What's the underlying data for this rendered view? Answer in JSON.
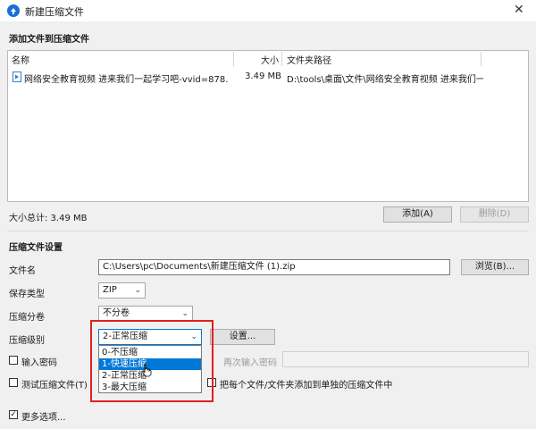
{
  "window": {
    "title": "新建压缩文件",
    "close_glyph": "✕",
    "icon": "app-logo-icon"
  },
  "add_files": {
    "section_title": "添加文件到压缩文件",
    "columns": {
      "name": "名称",
      "size": "大小",
      "path": "文件夹路径"
    },
    "rows": [
      {
        "name": "网络安全教育视频 进来我们一起学习吧-vvid=878...",
        "size": "3.49 MB",
        "path": "D:\\tools\\桌面\\文件\\网络安全教育视频 进来我们一..."
      }
    ],
    "total_label": "大小总计: 3.49 MB",
    "add_button": "添加(A)",
    "delete_button": "删除(D)"
  },
  "settings": {
    "section_title": "压缩文件设置",
    "filename_label": "文件名",
    "filename_value": "C:\\Users\\pc\\Documents\\新建压缩文件 (1).zip",
    "browse_button": "浏览(B)...",
    "type_label": "保存类型",
    "type_value": "ZIP",
    "split_label": "压缩分卷",
    "split_value": "不分卷",
    "level_label": "压缩级别",
    "level_value": "2-正常压缩",
    "level_options": [
      "0-不压缩",
      "1-快速压缩",
      "2-正常压缩",
      "3-最大压缩"
    ],
    "level_selected_index": 1,
    "settings_button": "设置...",
    "password_label": "输入密码",
    "reenter_password_placeholder": "再次输入密码",
    "test_label": "测试压缩文件(T)",
    "each_file_label": "把每个文件/文件夹添加到单独的压缩文件中",
    "more_options_label": "更多选项..."
  },
  "colors": {
    "accent": "#0078d7",
    "highlight_box": "#e02020"
  }
}
